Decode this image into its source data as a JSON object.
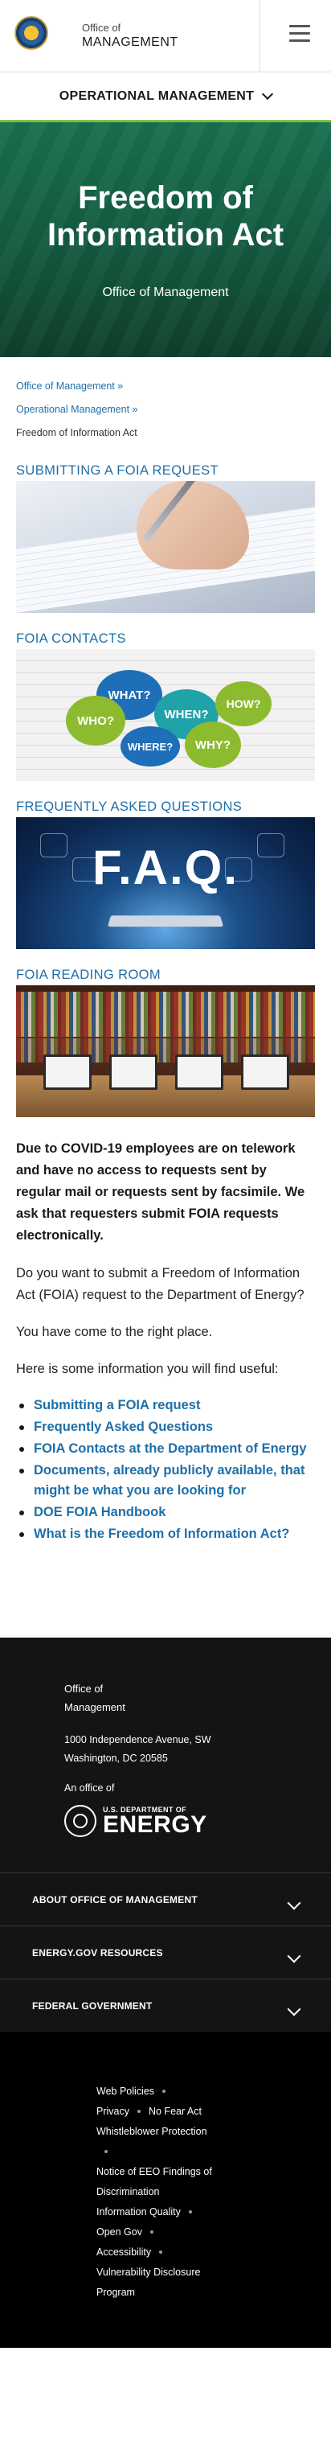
{
  "header": {
    "office_line1": "Office of",
    "office_line2": "MANAGEMENT",
    "menu_icon": "hamburger-menu-icon"
  },
  "subnav": {
    "label": "OPERATIONAL MANAGEMENT",
    "icon": "chevron-down-icon"
  },
  "hero": {
    "title": "Freedom of Information Act",
    "subtitle": "Office of Management"
  },
  "breadcrumb": {
    "items": [
      "Office of Management",
      "Operational Management"
    ],
    "separator": "»",
    "current": "Freedom of Information Act"
  },
  "sections": [
    {
      "title": "SUBMITTING A FOIA REQUEST"
    },
    {
      "title": "FOIA CONTACTS",
      "bubbles": [
        "WHAT?",
        "WHO?",
        "WHEN?",
        "HOW?",
        "WHERE?",
        "WHY?"
      ]
    },
    {
      "title": "FREQUENTLY ASKED QUESTIONS",
      "image_text": "F.A.Q."
    },
    {
      "title": "FOIA READING ROOM"
    }
  ],
  "content": {
    "notice": "Due to COVID-19 employees are on telework and have no access to requests sent by regular mail or requests sent by facsimile. We ask that requesters submit FOIA requests electronically.",
    "para1": "Do you want to submit a Freedom of Information Act (FOIA) request to the Department of Energy?",
    "para2": "You have come to the right place.",
    "para3": "Here is some information you will find useful:",
    "links": [
      "Submitting a FOIA request",
      "Frequently Asked Questions",
      "FOIA Contacts at the Department of Energy",
      "Documents, already publicly available, that might be what you are looking for",
      "DOE FOIA Handbook",
      "What is the Freedom of Information Act?"
    ]
  },
  "footer": {
    "office_line1": "Office of",
    "office_line2": "Management",
    "address_line1": "1000 Independence Avenue, SW",
    "address_line2": "Washington, DC 20585",
    "an_office_of": "An office of",
    "doe_small": "U.S. DEPARTMENT OF",
    "doe_big": "ENERGY",
    "accordions": [
      "ABOUT OFFICE OF MANAGEMENT",
      "ENERGY.GOV RESOURCES",
      "FEDERAL GOVERNMENT"
    ],
    "links": {
      "web_policies": "Web Policies",
      "privacy": "Privacy",
      "no_fear_act": "No Fear Act",
      "whistleblower": "Whistleblower Protection",
      "eeo": "Notice of EEO Findings of Discrimination",
      "info_quality": "Information Quality",
      "open_gov": "Open Gov",
      "accessibility": "Accessibility",
      "vdp": "Vulnerability Disclosure Program"
    }
  },
  "colors": {
    "link_blue": "#1f6fa8",
    "hero_green": "#14593f",
    "accent_green": "#7fc241",
    "footer_dark": "#141414"
  }
}
